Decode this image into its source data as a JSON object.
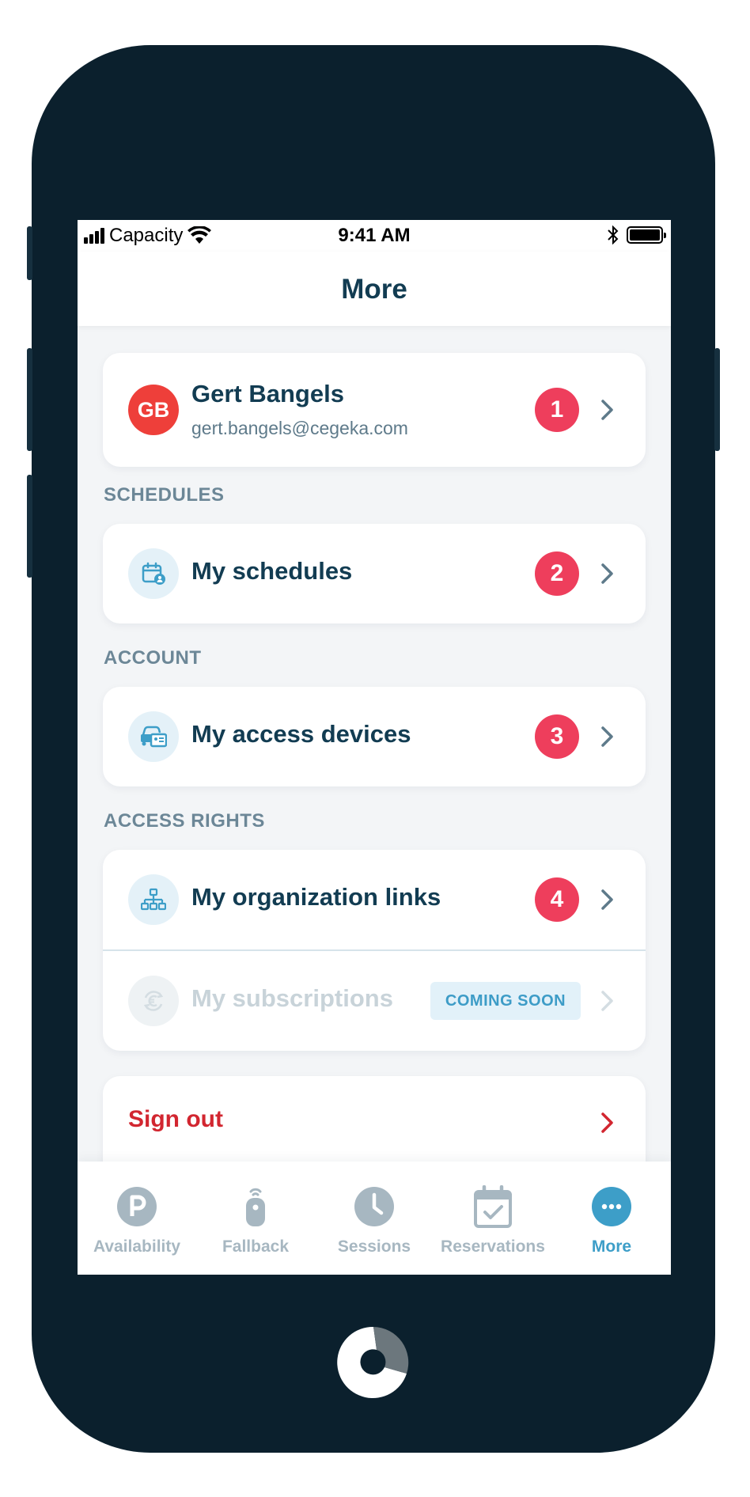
{
  "status_bar": {
    "carrier": "Capacity",
    "time": "9:41 AM"
  },
  "header": {
    "title": "More"
  },
  "profile": {
    "initials": "GB",
    "name": "Gert Bangels",
    "email": "gert.bangels@cegeka.com",
    "badge": "1"
  },
  "sections": {
    "schedules": {
      "label": "SCHEDULES",
      "item": {
        "title": "My schedules",
        "badge": "2",
        "icon": "calendar-user-icon"
      }
    },
    "account": {
      "label": "ACCOUNT",
      "item": {
        "title": "My access devices",
        "badge": "3",
        "icon": "car-card-icon"
      }
    },
    "access_rights": {
      "label": "ACCESS RIGHTS",
      "items": [
        {
          "title": "My organization links",
          "badge": "4",
          "icon": "org-chart-icon"
        },
        {
          "title": "My subscriptions",
          "tag": "COMING SOON",
          "icon": "euro-refresh-icon",
          "disabled": true
        }
      ]
    }
  },
  "sign_out": {
    "label": "Sign out"
  },
  "tabbar": {
    "tabs": [
      {
        "label": "Availability",
        "icon": "parking-icon",
        "active": false
      },
      {
        "label": "Fallback",
        "icon": "remote-icon",
        "active": false
      },
      {
        "label": "Sessions",
        "icon": "clock-icon",
        "active": false
      },
      {
        "label": "Reservations",
        "icon": "calendar-check-icon",
        "active": false
      },
      {
        "label": "More",
        "icon": "more-dots-icon",
        "active": true
      }
    ]
  },
  "colors": {
    "phone_body": "#0b202d",
    "primary_text": "#123c52",
    "accent": "#3d9ec8",
    "badge": "#ee3e5c",
    "sign_out": "#d22630",
    "avatar": "#ee3f3a"
  }
}
